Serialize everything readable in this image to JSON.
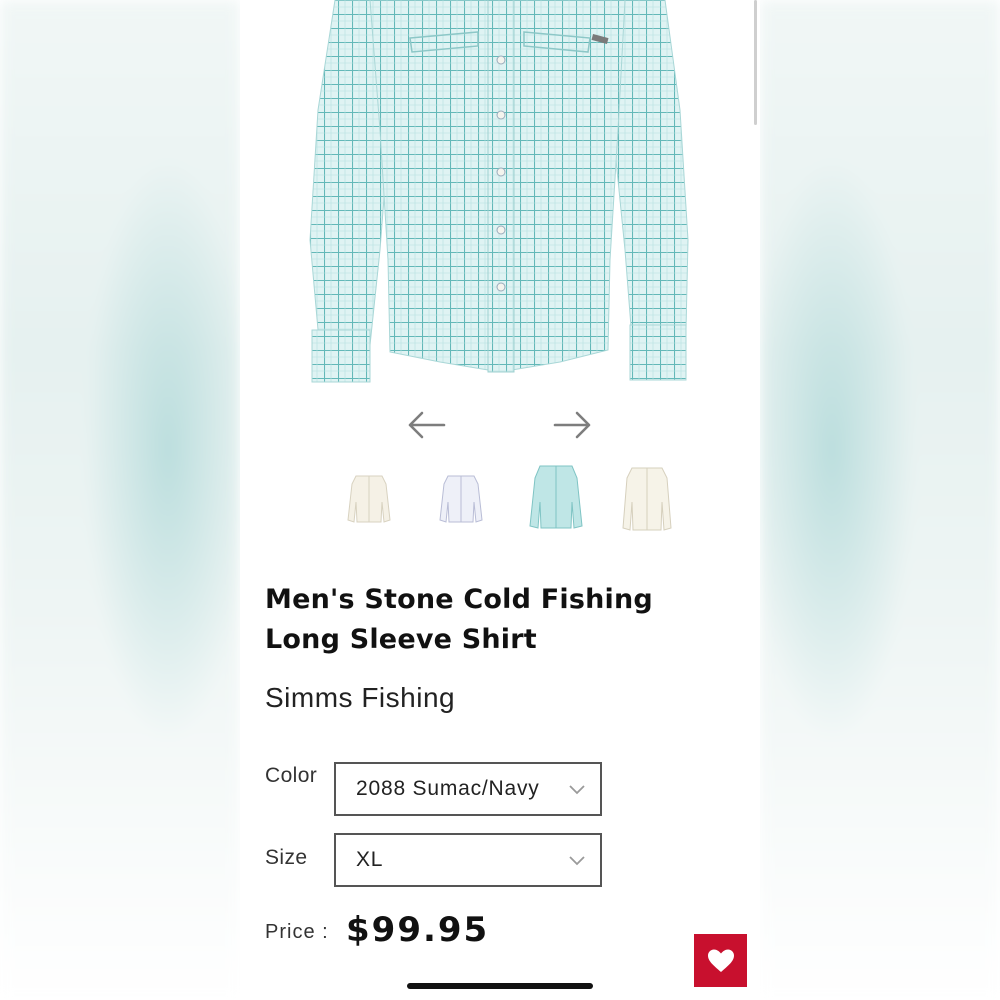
{
  "product": {
    "title": "Men's Stone Cold Fishing Long Sleeve Shirt",
    "brand": "Simms Fishing"
  },
  "gallery": {
    "prev_icon": "arrow-left-icon",
    "next_icon": "arrow-right-icon",
    "thumbnails": [
      {
        "color": "#f5f1e6"
      },
      {
        "color": "#eef0f8"
      },
      {
        "color": "#bfe6e6"
      },
      {
        "color": "#f6f3e8"
      }
    ],
    "selected_thumbnail": 3
  },
  "options": {
    "color": {
      "label": "Color",
      "value": "2088 Sumac/Navy"
    },
    "size": {
      "label": "Size",
      "value": "XL"
    }
  },
  "price": {
    "label": "Price :",
    "value": "$99.95"
  },
  "actions": {
    "favorite_icon": "heart-icon"
  },
  "colors": {
    "accent": "#c8102e",
    "shirt": "#c9ecec",
    "check_lines": "#5fb6b6"
  }
}
